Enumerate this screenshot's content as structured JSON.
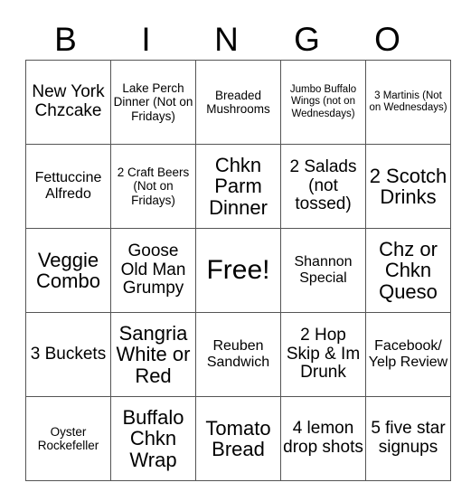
{
  "header": {
    "letters": [
      "B",
      "I",
      "N",
      "G",
      "O"
    ]
  },
  "grid": {
    "columns": 5,
    "rows": 5,
    "cells": [
      {
        "text": "New York Chzcake",
        "size": "lg"
      },
      {
        "text": "Lake Perch Dinner (Not on Fridays)",
        "size": "sm"
      },
      {
        "text": "Breaded Mushrooms",
        "size": "sm"
      },
      {
        "text": "Jumbo Buffalo Wings (not on Wednesdays)",
        "size": "xs"
      },
      {
        "text": "3 Martinis (Not on Wednesdays)",
        "size": "xs"
      },
      {
        "text": "Fettuccine Alfredo",
        "size": "md"
      },
      {
        "text": "2 Craft Beers (Not on Fridays)",
        "size": "sm"
      },
      {
        "text": "Chkn Parm Dinner",
        "size": "xl"
      },
      {
        "text": "2 Salads (not tossed)",
        "size": "lg"
      },
      {
        "text": "2 Scotch Drinks",
        "size": "xl"
      },
      {
        "text": "Veggie Combo",
        "size": "xl"
      },
      {
        "text": "Goose Old Man Grumpy",
        "size": "lg"
      },
      {
        "text": "Free!",
        "size": "free"
      },
      {
        "text": "Shannon Special",
        "size": "md"
      },
      {
        "text": "Chz or Chkn Queso",
        "size": "xl"
      },
      {
        "text": "3 Buckets",
        "size": "lg"
      },
      {
        "text": "Sangria White or Red",
        "size": "xl"
      },
      {
        "text": "Reuben Sandwich",
        "size": "md"
      },
      {
        "text": "2 Hop Skip & Im Drunk",
        "size": "lg"
      },
      {
        "text": "Facebook/ Yelp Review",
        "size": "md"
      },
      {
        "text": "Oyster Rockefeller",
        "size": "sm"
      },
      {
        "text": "Buffalo Chkn Wrap",
        "size": "xl"
      },
      {
        "text": "Tomato Bread",
        "size": "xl"
      },
      {
        "text": "4 lemon drop shots",
        "size": "lg"
      },
      {
        "text": "5 five star signups",
        "size": "lg"
      }
    ]
  }
}
